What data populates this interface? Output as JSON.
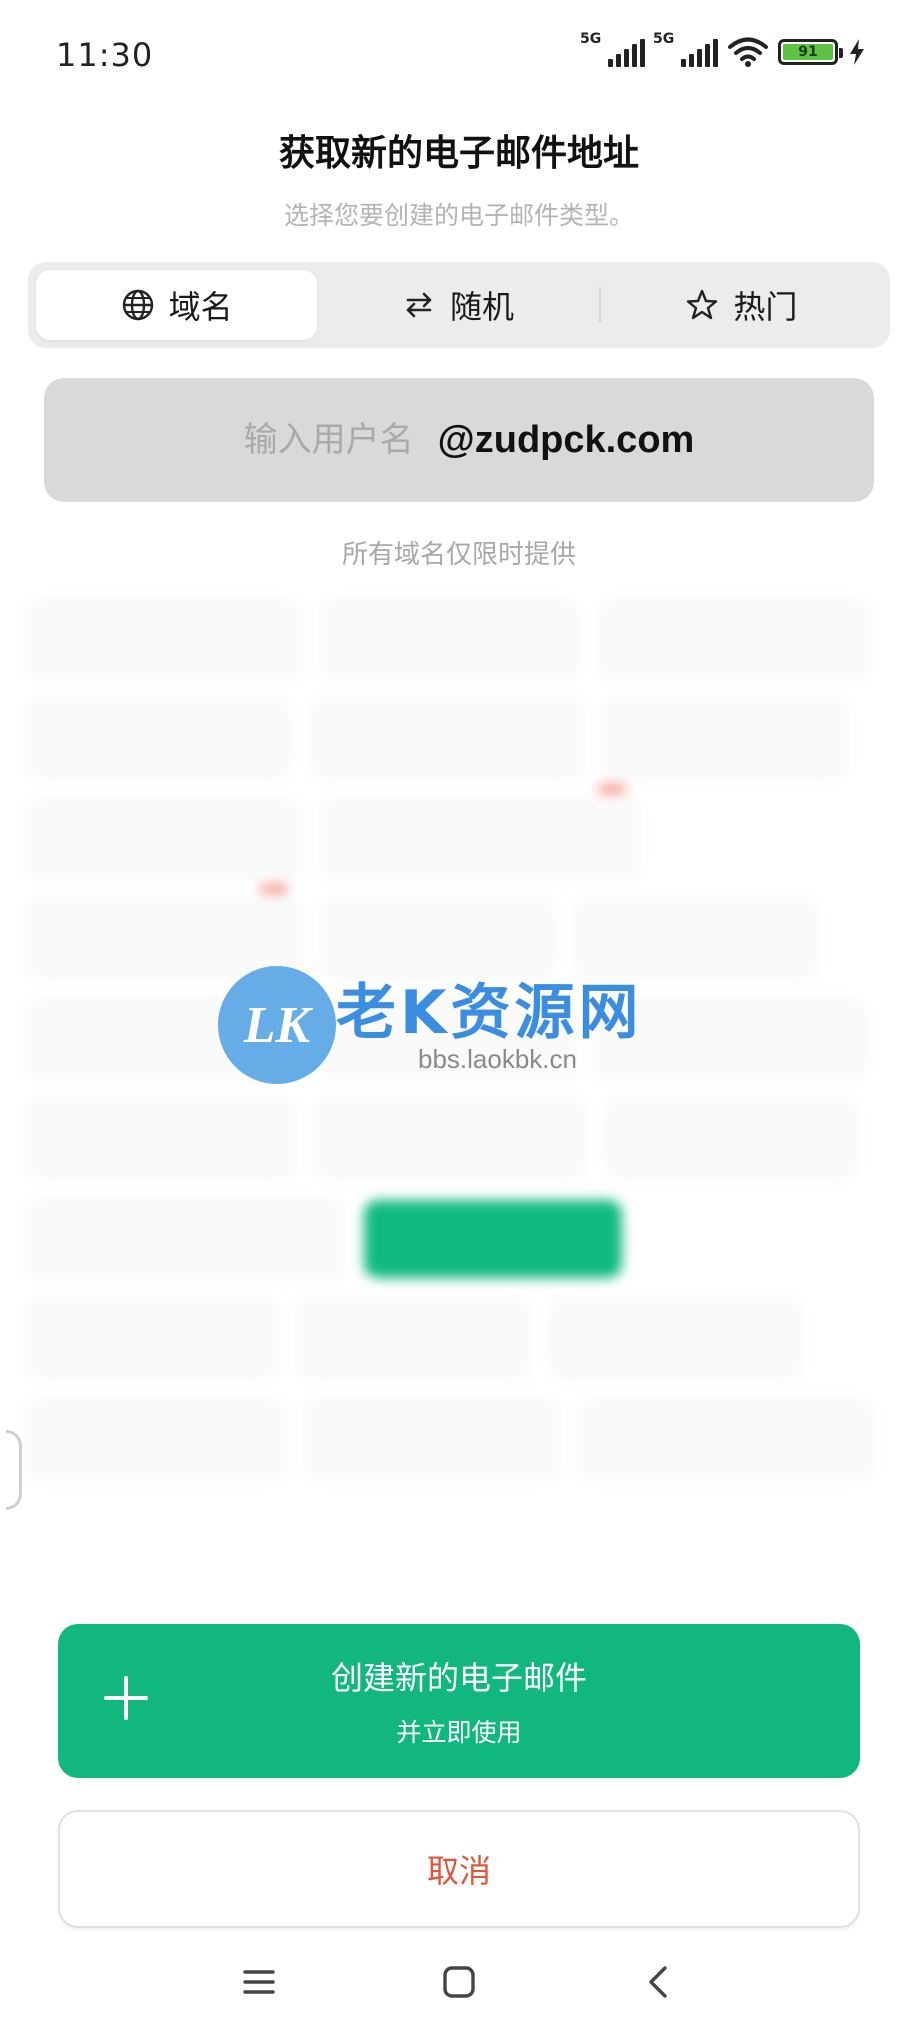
{
  "status_bar": {
    "time": "11:30",
    "signal1_label": "5G",
    "signal2_label": "5G",
    "battery": "91",
    "icons": [
      "signal-icon",
      "signal-icon",
      "wifi-icon",
      "battery-icon",
      "charging-icon"
    ]
  },
  "header": {
    "title": "获取新的电子邮件地址",
    "subtitle": "选择您要创建的电子邮件类型。"
  },
  "tabs": [
    {
      "label": "域名",
      "icon": "globe-icon",
      "active": true
    },
    {
      "label": "随机",
      "icon": "swap-icon",
      "active": false
    },
    {
      "label": "热门",
      "icon": "star-icon",
      "active": false
    }
  ],
  "username": {
    "placeholder": "输入用户名",
    "domain": "@zudpck.com"
  },
  "domain_note": "所有域名仅限时提供",
  "watermark": {
    "logo": "LK",
    "title": "老K资源网",
    "url": "bbs.laokbk.cn"
  },
  "actions": {
    "create_label": "创建新的电子邮件",
    "create_sub": "并立即使用",
    "cancel_label": "取消"
  },
  "colors": {
    "accent": "#12b77e",
    "cancel": "#e0563a"
  }
}
